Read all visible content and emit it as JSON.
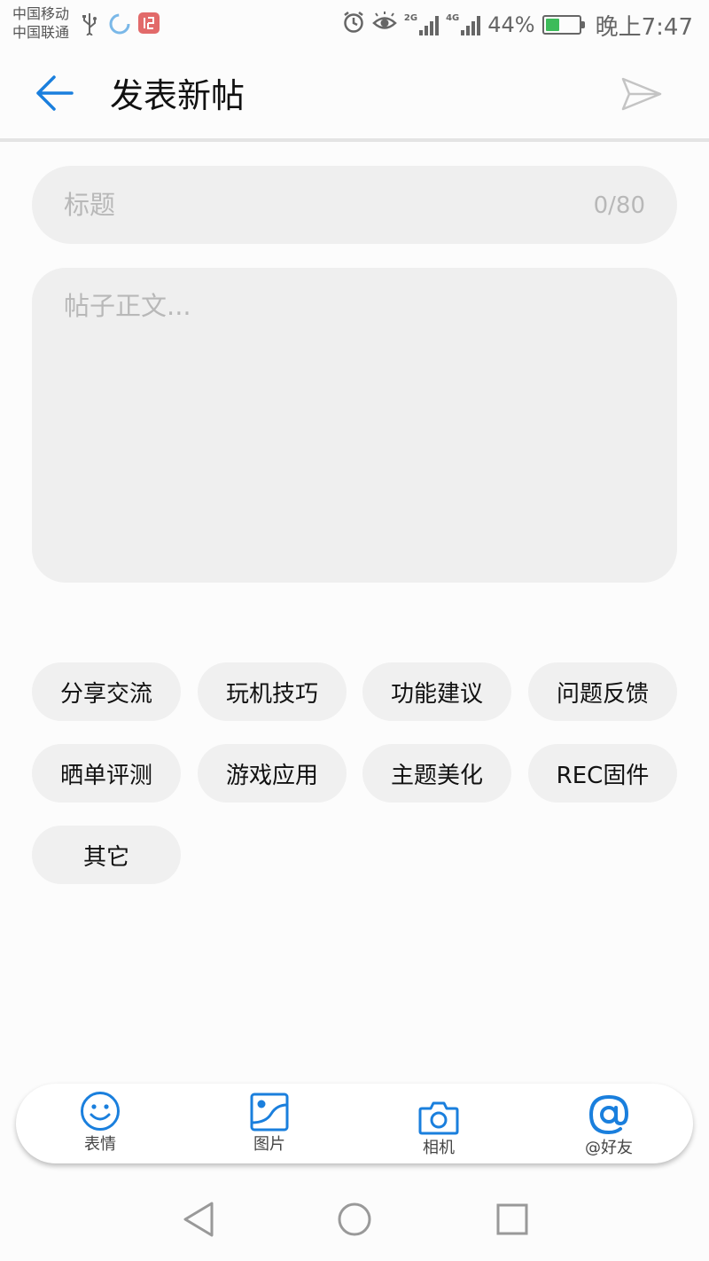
{
  "status_bar": {
    "carriers": [
      "中国移动",
      "中国联通"
    ],
    "net_2g": "2G",
    "net_4g": "4G",
    "battery_percent": "44%",
    "battery_level": 0.44,
    "time": "晚上7:47",
    "icons": [
      "usb-icon",
      "sync-icon",
      "app-notification-icon",
      "alarm-icon",
      "eye-comfort-icon",
      "signal-icon",
      "battery-icon"
    ]
  },
  "header": {
    "title": "发表新帖",
    "back_icon": "arrow-left-icon",
    "send_icon": "send-icon",
    "accent_color": "#1a7fdd"
  },
  "post_form": {
    "title_placeholder": "标题",
    "title_counter": "0/80",
    "body_placeholder": "帖子正文..."
  },
  "categories": [
    "分享交流",
    "玩机技巧",
    "功能建议",
    "问题反馈",
    "晒单评测",
    "游戏应用",
    "主题美化",
    "REC固件",
    "其它"
  ],
  "toolbar": {
    "items": [
      {
        "label": "表情",
        "icon": "emoji-icon"
      },
      {
        "label": "图片",
        "icon": "image-icon"
      },
      {
        "label": "相机",
        "icon": "camera-icon"
      },
      {
        "label": "@好友",
        "icon": "at-mention-icon"
      }
    ]
  },
  "nav_bar": {
    "icons": [
      "nav-back-icon",
      "nav-home-icon",
      "nav-recents-icon"
    ]
  }
}
